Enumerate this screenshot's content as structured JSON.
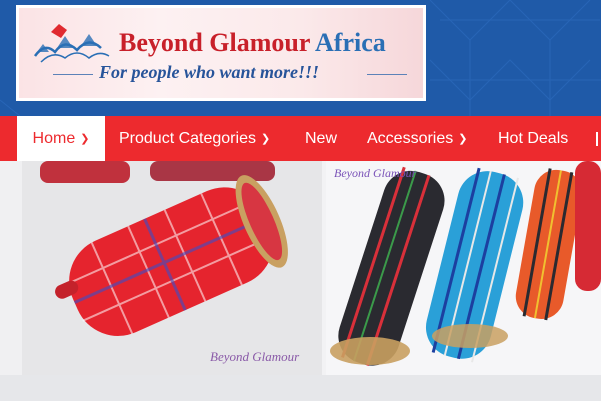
{
  "brand": {
    "name_red": "Beyond Glamour",
    "name_blue": "Africa",
    "tagline": "For people who want more!!!",
    "colors": {
      "header_bg": "#1f5aa8",
      "nav_bg": "#ed2a2e",
      "brand_red": "#c8202a",
      "brand_blue": "#2a6fb5"
    }
  },
  "nav": {
    "items": [
      {
        "label": "Home",
        "has_dropdown": true,
        "active": true
      },
      {
        "label": "Product Categories",
        "has_dropdown": true,
        "active": false
      },
      {
        "label": "New",
        "has_dropdown": false,
        "active": false
      },
      {
        "label": "Accessories",
        "has_dropdown": true,
        "active": false
      },
      {
        "label": "Hot Deals",
        "has_dropdown": false,
        "active": false
      }
    ],
    "dropdown_icon": "chevron-down-icon"
  },
  "banner": {
    "watermark_left": "Beyond Glamour",
    "watermark_right": "Beyond Glamour"
  }
}
